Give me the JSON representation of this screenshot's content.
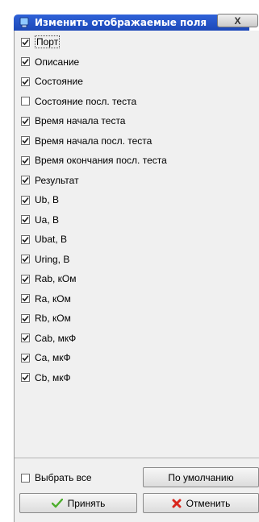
{
  "window": {
    "title": "Изменить отображаемые поля",
    "close_glyph": "X"
  },
  "fields": [
    {
      "label": "Порт",
      "checked": true
    },
    {
      "label": "Описание",
      "checked": true
    },
    {
      "label": "Состояние",
      "checked": true
    },
    {
      "label": "Состояние посл. теста",
      "checked": false
    },
    {
      "label": "Время начала теста",
      "checked": true
    },
    {
      "label": "Время начала посл. теста",
      "checked": true
    },
    {
      "label": "Время окончания посл. теста",
      "checked": true
    },
    {
      "label": "Результат",
      "checked": true
    },
    {
      "label": "Ub, В",
      "checked": true
    },
    {
      "label": "Ua, В",
      "checked": true
    },
    {
      "label": "Ubat, В",
      "checked": true
    },
    {
      "label": "Uring, В",
      "checked": true
    },
    {
      "label": "Rab, кОм",
      "checked": true
    },
    {
      "label": "Ra, кОм",
      "checked": true
    },
    {
      "label": "Rb, кОм",
      "checked": true
    },
    {
      "label": "Cab, мкФ",
      "checked": true
    },
    {
      "label": "Ca, мкФ",
      "checked": true
    },
    {
      "label": "Cb, мкФ",
      "checked": true
    }
  ],
  "footer": {
    "select_all_label": "Выбрать все",
    "select_all_checked": false,
    "defaults_label": "По умолчанию",
    "accept_label": "Принять",
    "cancel_label": "Отменить"
  },
  "colors": {
    "titlebar": "#2f62d8",
    "accept_icon": "#4cae2c",
    "cancel_icon": "#d9261c"
  },
  "icons": {
    "window": "window-app-icon",
    "accept": "checkmark-icon",
    "cancel": "cross-icon"
  }
}
